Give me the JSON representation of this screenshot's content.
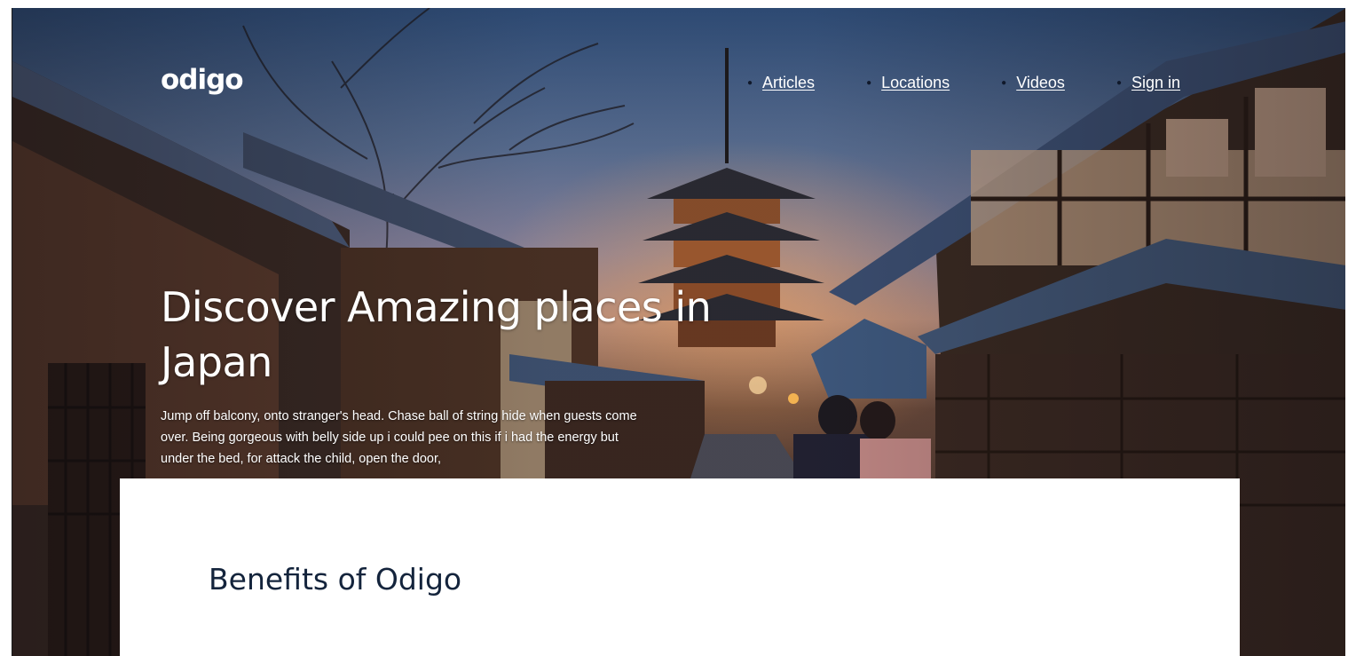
{
  "brand": {
    "logo": "odigo"
  },
  "nav": {
    "items": [
      {
        "label": "Articles"
      },
      {
        "label": "Locations"
      },
      {
        "label": "Videos"
      },
      {
        "label": "Sign in"
      }
    ]
  },
  "hero": {
    "title": "Discover Amazing places in Japan",
    "description": "Jump off balcony, onto stranger's head. Chase ball of string hide when guests come over. Being gorgeous with belly side up i could pee on this if i had the energy but under the bed, for attack the child, open the door,",
    "image": "kyoto-street-pagoda-photo"
  },
  "section": {
    "heading": "Benefits of Odigo"
  },
  "colors": {
    "heading": "#14243c",
    "nav_text": "#ffffff",
    "card_bg": "#ffffff"
  }
}
